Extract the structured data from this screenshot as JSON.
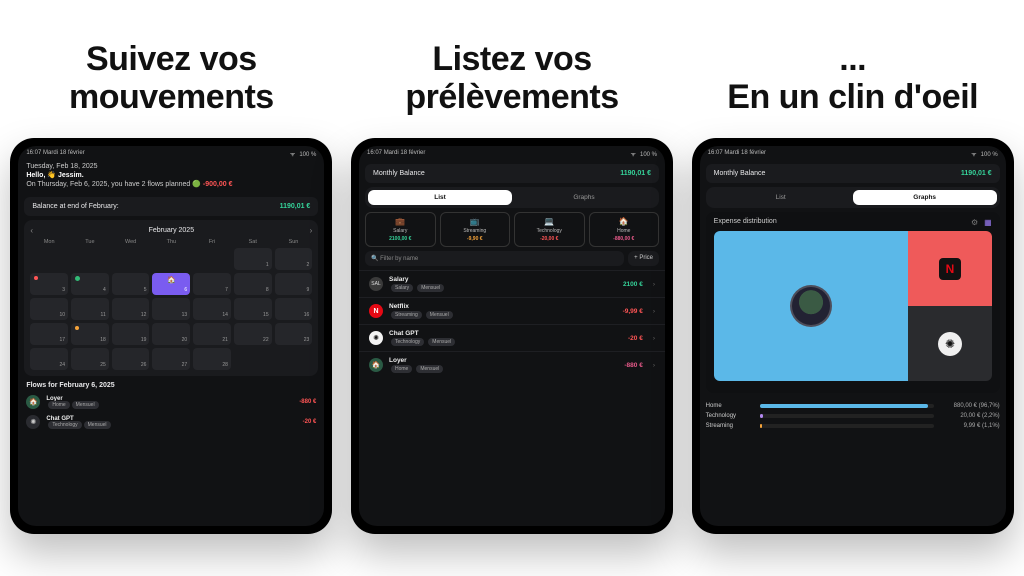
{
  "headlines": {
    "col1": "Suivez vos\nmouvements",
    "col2": "Listez vos\nprélèvements",
    "col3_pre": "...",
    "col3": "En un clin d'oeil"
  },
  "status": {
    "time": "16:07",
    "date": "Mardi 18 février",
    "wifi": "100 %"
  },
  "panel1": {
    "date_line": "Tuesday, Feb 18, 2025",
    "hello": "Hello, 👋 Jessim.",
    "summary_pre": "On Thursday, Feb 6, 2025, you have 2 flows planned ",
    "summary_in": "🟢",
    "summary_out": "-900,00 €",
    "balance_label": "Balance at end of February:",
    "balance_value": "1190,01 €",
    "month": "February 2025",
    "weekdays": [
      "Mon",
      "Tue",
      "Wed",
      "Thu",
      "Fri",
      "Sat",
      "Sun"
    ],
    "days": [
      1,
      2,
      3,
      4,
      5,
      6,
      7,
      8,
      9,
      10,
      11,
      12,
      13,
      14,
      15,
      16,
      17,
      18,
      19,
      20,
      21,
      22,
      23,
      24,
      25,
      26,
      27,
      28
    ],
    "selected_day": 6,
    "flows_header": "Flows for February 6, 2025",
    "flows": [
      {
        "icon": "🏠",
        "name": "Loyer",
        "tags": [
          "Home",
          "Mensuel"
        ],
        "amount": "-880 €",
        "neg": true
      },
      {
        "icon": "✺",
        "name": "Chat GPT",
        "tags": [
          "Technology",
          "Mensuel"
        ],
        "amount": "-20 €",
        "neg": true
      }
    ]
  },
  "panel2": {
    "balance_label": "Monthly Balance",
    "balance_value": "1190,01 €",
    "tabs": {
      "list": "List",
      "graphs": "Graphs"
    },
    "categories": [
      {
        "icon": "💼",
        "label": "Salary",
        "value": "2100,00 €",
        "cls": "g"
      },
      {
        "icon": "📺",
        "label": "Streaming",
        "value": "-9,90 €",
        "cls": "o"
      },
      {
        "icon": "💻",
        "label": "Technology",
        "value": "-20,00 €",
        "cls": "r"
      },
      {
        "icon": "🏠",
        "label": "Home",
        "value": "-880,00 €",
        "cls": "m"
      }
    ],
    "search_placeholder": "Filter by name",
    "price_btn": "+ Price",
    "items": [
      {
        "ico": "sal",
        "glyph": "SAL",
        "title": "Salary",
        "tags": [
          "Salary",
          "Mensuel"
        ],
        "amount": "2100 €",
        "cls": "g"
      },
      {
        "ico": "nfx",
        "glyph": "N",
        "title": "Netflix",
        "tags": [
          "Streaming",
          "Mensuel"
        ],
        "amount": "-9,99 €",
        "cls": "r"
      },
      {
        "ico": "gpt",
        "glyph": "✺",
        "title": "Chat GPT",
        "tags": [
          "Technology",
          "Mensuel"
        ],
        "amount": "-20 €",
        "cls": "r"
      },
      {
        "ico": "loy",
        "glyph": "🏠",
        "title": "Loyer",
        "tags": [
          "Home",
          "Mensuel"
        ],
        "amount": "-880 €",
        "cls": "m"
      }
    ]
  },
  "panel3": {
    "balance_label": "Monthly Balance",
    "balance_value": "1190,01 €",
    "tabs": {
      "list": "List",
      "graphs": "Graphs"
    },
    "dist_title": "Expense distribution",
    "bars": [
      {
        "label": "Home",
        "value": "880,00 € (96,7%)",
        "pct": 96.7,
        "cls": "home"
      },
      {
        "label": "Technology",
        "value": "20,00 € (2,2%)",
        "pct": 2.2,
        "cls": "tech"
      },
      {
        "label": "Streaming",
        "value": "9,99 € (1,1%)",
        "pct": 1.1,
        "cls": "strm"
      }
    ]
  },
  "chart_data": {
    "type": "treemap+bar",
    "title": "Expense distribution",
    "series": [
      {
        "name": "Home",
        "value": 880.0,
        "pct": 96.7
      },
      {
        "name": "Technology",
        "value": 20.0,
        "pct": 2.2
      },
      {
        "name": "Streaming",
        "value": 9.99,
        "pct": 1.1
      }
    ],
    "currency": "€",
    "monthly_balance": 1190.01
  }
}
